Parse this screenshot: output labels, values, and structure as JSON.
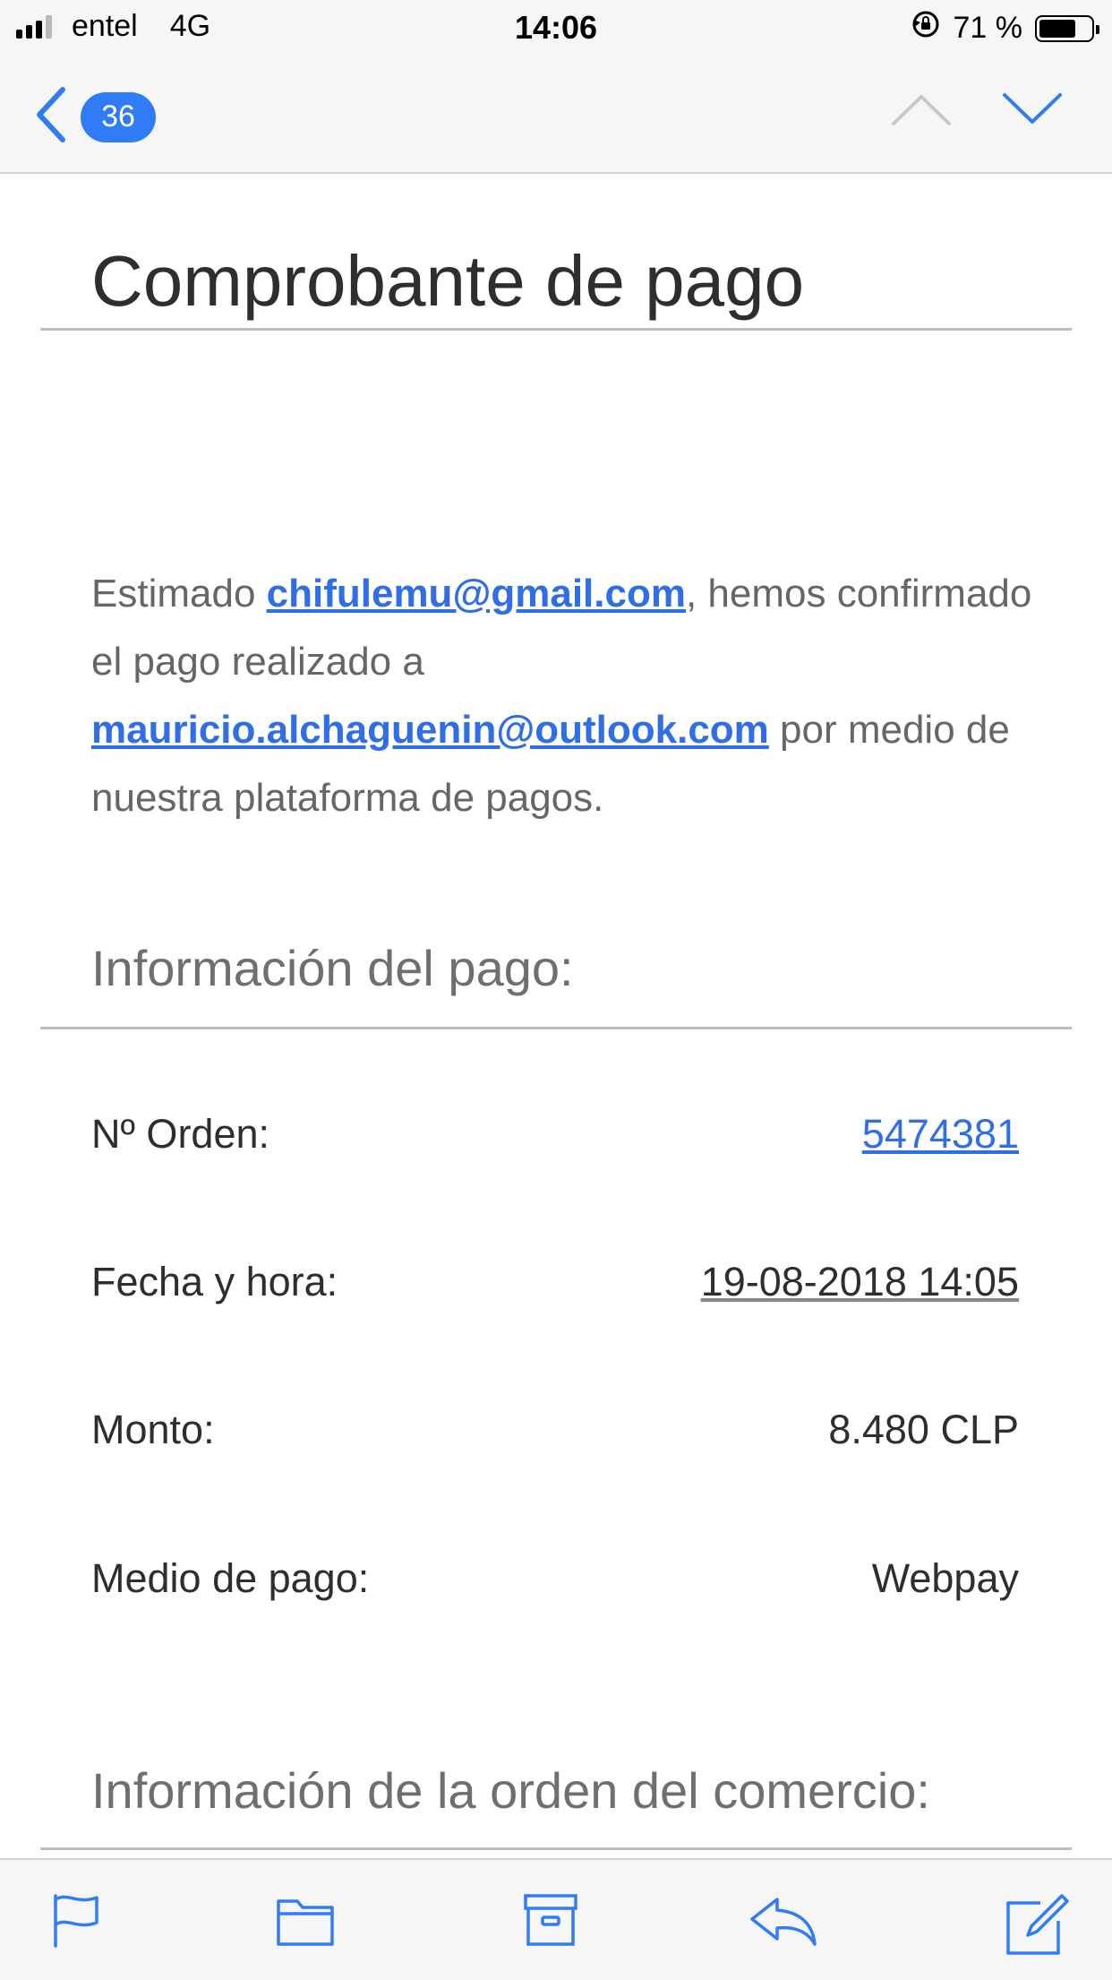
{
  "status_bar": {
    "carrier": "entel",
    "network": "4G",
    "time": "14:06",
    "battery_percent": "71 %",
    "battery_level": 0.71
  },
  "nav": {
    "unread_count": "36",
    "icons": [
      "back-chevron-icon",
      "chevron-up-icon",
      "chevron-down-icon"
    ]
  },
  "email": {
    "title": "Comprobante de pago",
    "intro": {
      "part1": "Estimado ",
      "sender_email": "chifulemu@gmail.com",
      "part2": ", hemos confirmado el pago realizado a ",
      "recipient_email": "mauricio.alchaguenin@outlook.com",
      "part3": " por medio de nuestra plataforma de pagos."
    },
    "payment_section_title": "Información del pago:",
    "payment_rows": [
      {
        "label": "Nº Orden:",
        "value": "5474381"
      },
      {
        "label": "Fecha y hora:",
        "value": "19-08-2018 14:05"
      },
      {
        "label": "Monto:",
        "value": "8.480 CLP"
      },
      {
        "label": "Medio de pago:",
        "value": "Webpay"
      }
    ],
    "order_section_title": "Información de la orden del comercio:"
  },
  "toolbar": {
    "icons": [
      "flag-icon",
      "folder-icon",
      "archive-icon",
      "reply-icon",
      "compose-icon"
    ]
  },
  "colors": {
    "accent": "#2f7cf6",
    "link": "#2f6ee6",
    "bar_background": "#f6f6f7"
  }
}
